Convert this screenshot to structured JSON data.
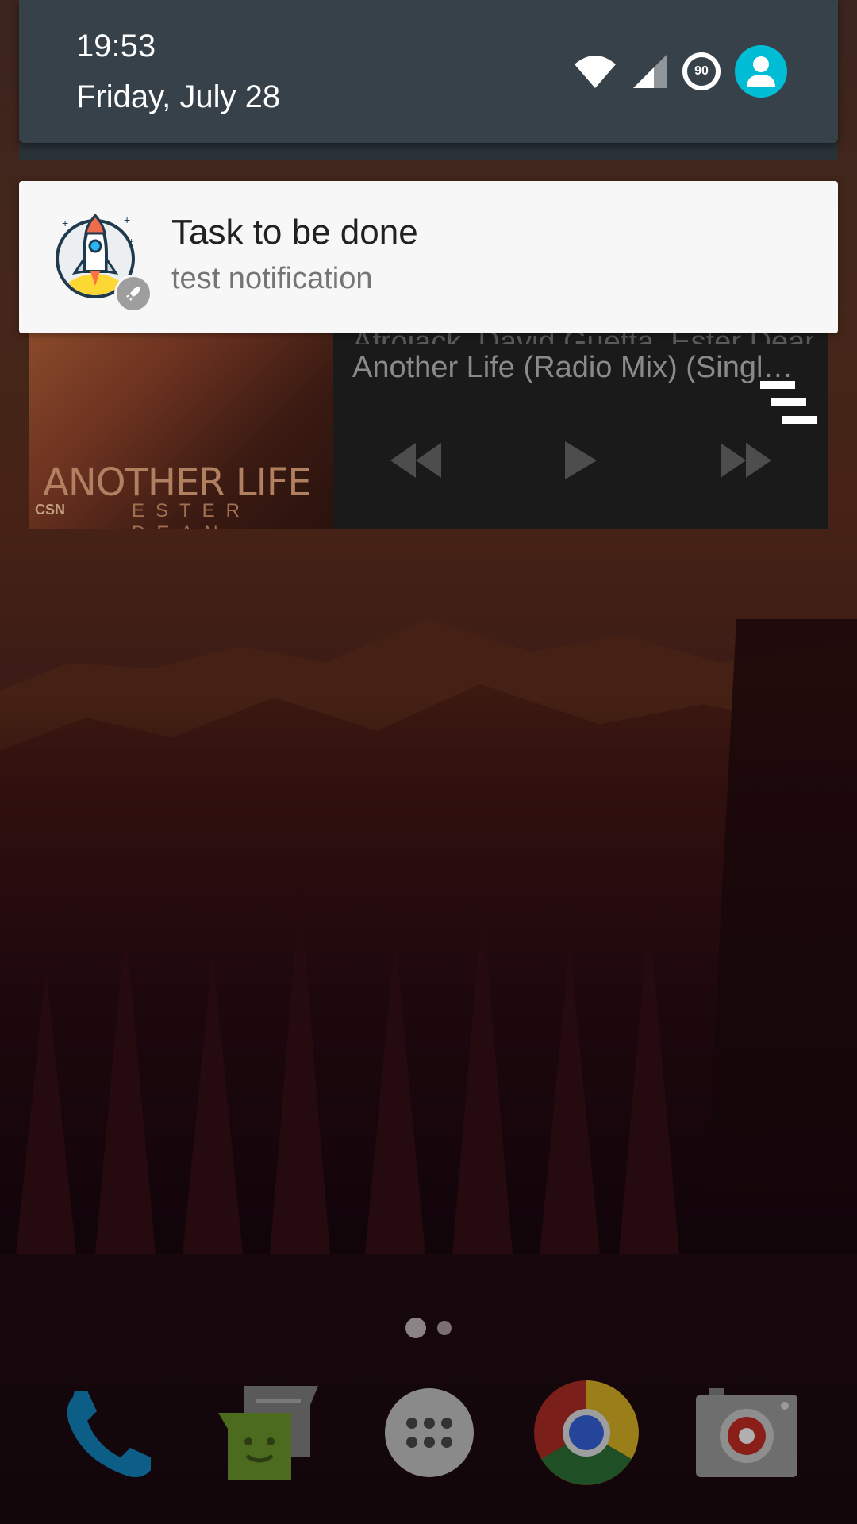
{
  "status": {
    "time": "19:53",
    "date": "Friday, July 28",
    "battery_level": "90",
    "colors": {
      "header_bg": "#37414a",
      "avatar": "#00bcd4"
    }
  },
  "notification": {
    "title": "Task to be done",
    "text": "test notification",
    "icon": "rocket-launch-icon",
    "badge_icon": "rocket-small-icon"
  },
  "media": {
    "artist": "Afrojack, David Guetta, Ester Dean",
    "track": "Another Life (Radio Mix) (Singl…",
    "album_art_title": "ANOTHER LIFE",
    "album_art_artist": "ESTER DEAN",
    "album_art_logo": "CSN",
    "controls": [
      "rewind-icon",
      "play-icon",
      "fast-forward-icon"
    ]
  },
  "home": {
    "page_count": 2,
    "active_page": 1,
    "dock": [
      {
        "name": "phone",
        "icon": "phone-icon"
      },
      {
        "name": "messenger",
        "icon": "messenger-icon"
      },
      {
        "name": "app-drawer",
        "icon": "app-drawer-icon"
      },
      {
        "name": "chrome",
        "icon": "chrome-icon"
      },
      {
        "name": "camera",
        "icon": "camera-icon"
      }
    ]
  }
}
